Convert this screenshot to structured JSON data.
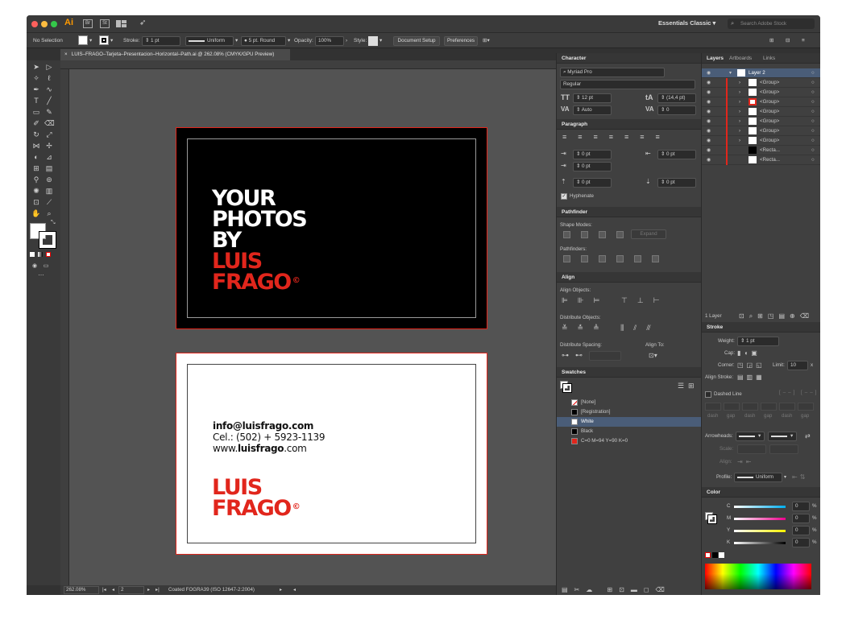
{
  "app": {
    "logo": "Ai",
    "br": "Br",
    "st": "St",
    "workspace": "Essentials Classic",
    "search_placeholder": "Search Adobe Stock"
  },
  "control_bar": {
    "selection": "No Selection",
    "stroke_label": "Stroke:",
    "stroke_weight": "1 pt",
    "uniform": "Uniform",
    "brush": "5 pt. Round",
    "opacity_label": "Opacity:",
    "opacity": "100%",
    "style_label": "Style:",
    "document_setup": "Document Setup",
    "preferences": "Preferences"
  },
  "document_tab": {
    "close": "×",
    "title": "LUIS–FRAGO–Tarjeta–Presentacion–Horizontal–Path.ai @ 262.08% (CMYK/GPU Preview)"
  },
  "artboard_front": {
    "line1": "YOUR",
    "line2": "PHOTOS",
    "line3": "BY",
    "line4": "LUIS",
    "line5": "FRAGO",
    "copyright": "©"
  },
  "artboard_back": {
    "email": "info@luisfrago.com",
    "phone": "Cel.: (502) + 5923-1139",
    "web_prefix": "www.",
    "web_bold": "luisfrago",
    "web_suffix": ".com",
    "logo1": "LUIS",
    "logo2": "FRAGO",
    "copyright": "©"
  },
  "status_bar": {
    "zoom": "262.08%",
    "artboard": "2",
    "profile": "Coated FOGRA39 (ISO 12647-2:2004)"
  },
  "character": {
    "title": "Character",
    "font": "Myriad Pro",
    "style": "Regular",
    "size": "12 pt",
    "leading": "(14,4 pt)",
    "kerning": "Auto",
    "tracking": "0"
  },
  "paragraph": {
    "title": "Paragraph",
    "left_indent": "0 pt",
    "right_indent": "0 pt",
    "first_indent": "0 pt",
    "space_before": "0 pt",
    "space_after": "0 pt",
    "hyphenate": "Hyphenate"
  },
  "pathfinder": {
    "title": "Pathfinder",
    "shape_modes": "Shape Modes:",
    "pathfinders": "Pathfinders:",
    "expand": "Expand"
  },
  "align": {
    "title": "Align",
    "align_objects": "Align Objects:",
    "distribute_objects": "Distribute Objects:",
    "distribute_spacing": "Distribute Spacing:",
    "align_to": "Align To:"
  },
  "swatches": {
    "title": "Swatches",
    "items": [
      {
        "name": "[None]"
      },
      {
        "name": "[Registration]"
      },
      {
        "name": "White"
      },
      {
        "name": "Black"
      },
      {
        "name": "C=0 M=94 Y=90 K=0"
      }
    ]
  },
  "layers": {
    "tabs": [
      "Layers",
      "Artboards",
      "Links"
    ],
    "rows": [
      {
        "name": "Layer 2"
      },
      {
        "name": "<Group>"
      },
      {
        "name": "<Group>"
      },
      {
        "name": "<Group>"
      },
      {
        "name": "<Group>"
      },
      {
        "name": "<Group>"
      },
      {
        "name": "<Group>"
      },
      {
        "name": "<Group>"
      },
      {
        "name": "<Recta..."
      },
      {
        "name": "<Recta..."
      }
    ],
    "count": "1 Layer"
  },
  "stroke": {
    "title": "Stroke",
    "weight_label": "Weight:",
    "weight": "1 pt",
    "cap": "Cap:",
    "corner": "Corner:",
    "limit_label": "Limit:",
    "limit": "10",
    "limit_x": "x",
    "align_stroke": "Align Stroke:",
    "dashed": "Dashed Line",
    "dash_labels": [
      "dash",
      "gap",
      "dash",
      "gap",
      "dash",
      "gap"
    ],
    "arrowheads": "Arrowheads:",
    "scale": "Scale:",
    "align": "Align:",
    "profile": "Profile:",
    "uniform": "Uniform"
  },
  "color": {
    "title": "Color",
    "channels": [
      {
        "label": "C",
        "value": "0",
        "pct": "%"
      },
      {
        "label": "M",
        "value": "0",
        "pct": "%"
      },
      {
        "label": "Y",
        "value": "0",
        "pct": "%"
      },
      {
        "label": "K",
        "value": "0",
        "pct": "%"
      }
    ]
  },
  "colors": {
    "red": "#e1261c",
    "black": "#000000",
    "white": "#ffffff"
  }
}
